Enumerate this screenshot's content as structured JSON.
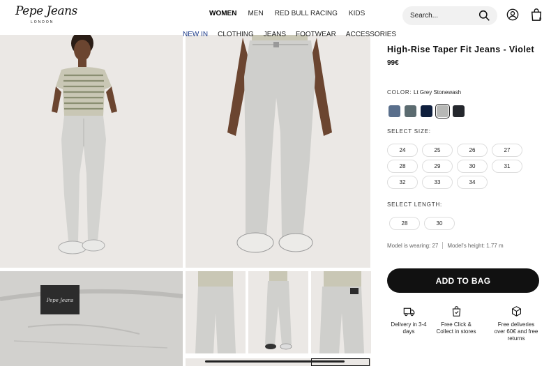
{
  "header": {
    "logo_text": "Pepe Jeans",
    "logo_sub": "LONDON",
    "nav": [
      "WOMEN",
      "MEN",
      "RED BULL RACING",
      "KIDS"
    ],
    "search_placeholder": "Search...",
    "bag_count": "0",
    "icons": [
      "search-icon",
      "user-icon",
      "bag-icon"
    ]
  },
  "sub_nav": [
    "NEW IN",
    "CLOTHING",
    "JEANS",
    "FOOTWEAR",
    "ACCESSORIES"
  ],
  "product": {
    "title": "High-Rise Taper Fit Jeans - Violet",
    "price": "99€",
    "color_label": "COLOR:",
    "color_name": "Lt Grey Stonewash",
    "swatches": [
      "#5a6f8c",
      "#5b6b70",
      "#0f1f3d",
      "#b7b8b6",
      "#24272d"
    ],
    "selected_swatch": 3,
    "size_label": "SELECT SIZE:",
    "sizes": [
      "24",
      "25",
      "26",
      "27",
      "28",
      "29",
      "30",
      "31",
      "32",
      "33",
      "34"
    ],
    "length_label": "SELECT LENGTH:",
    "lengths": [
      "28",
      "30"
    ],
    "model_wearing": "Model is wearing: 27",
    "model_height": "Model's height: 1.77 m",
    "add_to_bag": "ADD TO BAG"
  },
  "perks": [
    {
      "icon": "truck-icon",
      "text": "Delivery in 3-4 days"
    },
    {
      "icon": "store-bag-icon",
      "text": "Free Click & Collect in stores"
    },
    {
      "icon": "box-icon",
      "text": "Free deliveries over 60€ and free returns"
    }
  ]
}
